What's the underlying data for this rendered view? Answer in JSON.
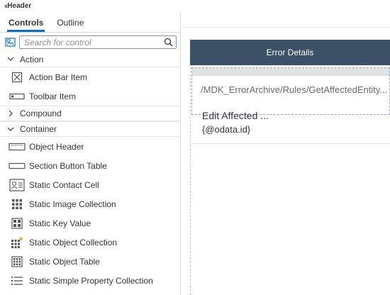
{
  "header": {
    "back_icon": "double-chevron-left-icon",
    "title": "Header"
  },
  "sidebar": {
    "tabs": [
      {
        "label": "Controls",
        "active": true
      },
      {
        "label": "Outline",
        "active": false
      }
    ],
    "search": {
      "placeholder": "Search for control",
      "value": ""
    },
    "groups": [
      {
        "label": "Action",
        "expanded": true,
        "caret": "chevron-down-icon"
      },
      {
        "label": "Compound",
        "expanded": false,
        "caret": "chevron-right-icon"
      },
      {
        "label": "Container",
        "expanded": true,
        "caret": "chevron-down-icon"
      }
    ],
    "action_items": [
      {
        "label": "Action Bar Item",
        "icon": "action-bar-item-icon"
      },
      {
        "label": "Toolbar Item",
        "icon": "toolbar-item-icon"
      }
    ],
    "container_items": [
      {
        "label": "Object Header",
        "icon": "object-header-icon"
      },
      {
        "label": "Section Button Table",
        "icon": "section-button-table-icon"
      },
      {
        "label": "Static Contact Cell",
        "icon": "contact-cell-icon"
      },
      {
        "label": "Static Image Collection",
        "icon": "image-collection-icon"
      },
      {
        "label": "Static Key Value",
        "icon": "key-value-icon"
      },
      {
        "label": "Static Object Collection",
        "icon": "object-collection-icon"
      },
      {
        "label": "Static Object Table",
        "icon": "object-table-icon"
      },
      {
        "label": "Static Simple Property Collection",
        "icon": "simple-property-collection-icon"
      }
    ]
  },
  "canvas": {
    "page_title": "Error Details",
    "selected_rule_path": "/MDK_ErrorArchive/Rules/GetAffectedEntity...",
    "item_title": "Edit Affected ...",
    "item_subtitle": "{@odata.id}"
  },
  "colors": {
    "accent": "#0a6ed1",
    "page_header_bg": "#3c5066",
    "text": "#32363a"
  }
}
